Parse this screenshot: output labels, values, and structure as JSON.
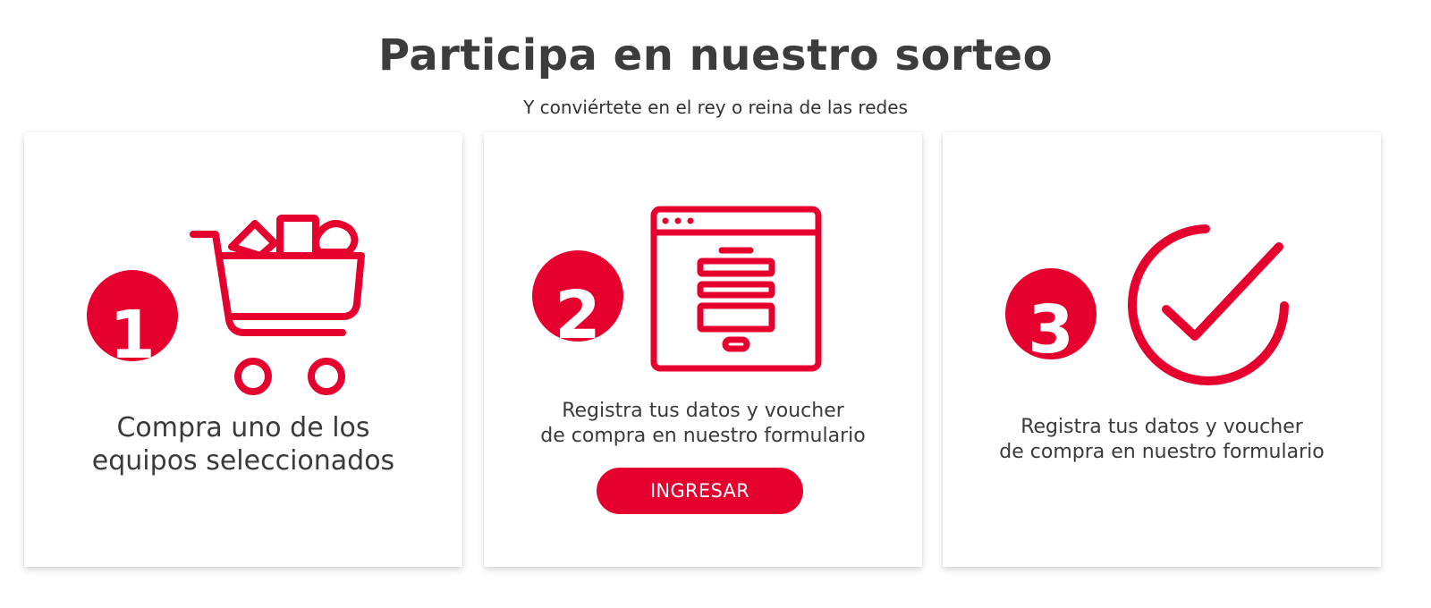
{
  "header": {
    "title": "Participa en nuestro sorteo",
    "subtitle": "Y conviértete en el rey o reina de las redes"
  },
  "steps": [
    {
      "number": "1",
      "icon": "shopping-cart-icon",
      "text_lines": [
        "Compra uno de los",
        "equipos seleccionados"
      ]
    },
    {
      "number": "2",
      "icon": "web-form-icon",
      "text_lines": [
        "Registra tus datos y voucher",
        "de compra en nuestro formulario"
      ],
      "button_label": "INGRESAR"
    },
    {
      "number": "3",
      "icon": "check-circle-icon",
      "text_lines": [
        "Registra tus datos y voucher",
        "de compra en nuestro formulario"
      ]
    }
  ],
  "colors": {
    "accent": "#e6002d",
    "text": "#3a3a3a",
    "card_background": "#ffffff"
  }
}
